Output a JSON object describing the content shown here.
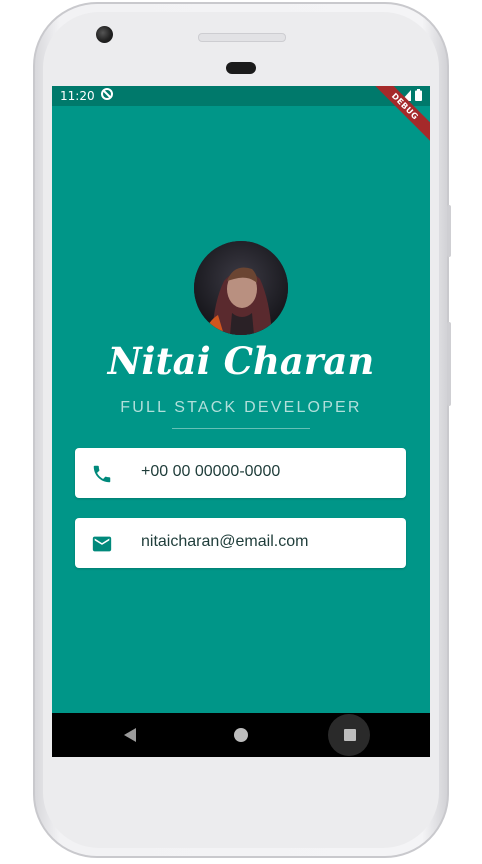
{
  "status_bar": {
    "time": "11:20",
    "debug_label": "DEBUG"
  },
  "profile": {
    "name": "Nitai Charan",
    "title": "FULL STACK DEVELOPER"
  },
  "contacts": {
    "phone": "+00 00 00000-0000",
    "email": "nitaicharan@email.com"
  },
  "icons": {
    "sync": "sync-icon",
    "wifi": "wifi-icon",
    "signal": "signal-icon",
    "battery": "battery-icon",
    "phone": "phone-icon",
    "email": "email-icon",
    "back": "back-triangle-icon",
    "home": "home-circle-icon",
    "recents": "recents-square-icon"
  },
  "colors": {
    "primary": "#009688",
    "status_bar": "#00796b",
    "subtitle": "#b2dfdb",
    "card": "#ffffff",
    "icon": "#00897b"
  }
}
